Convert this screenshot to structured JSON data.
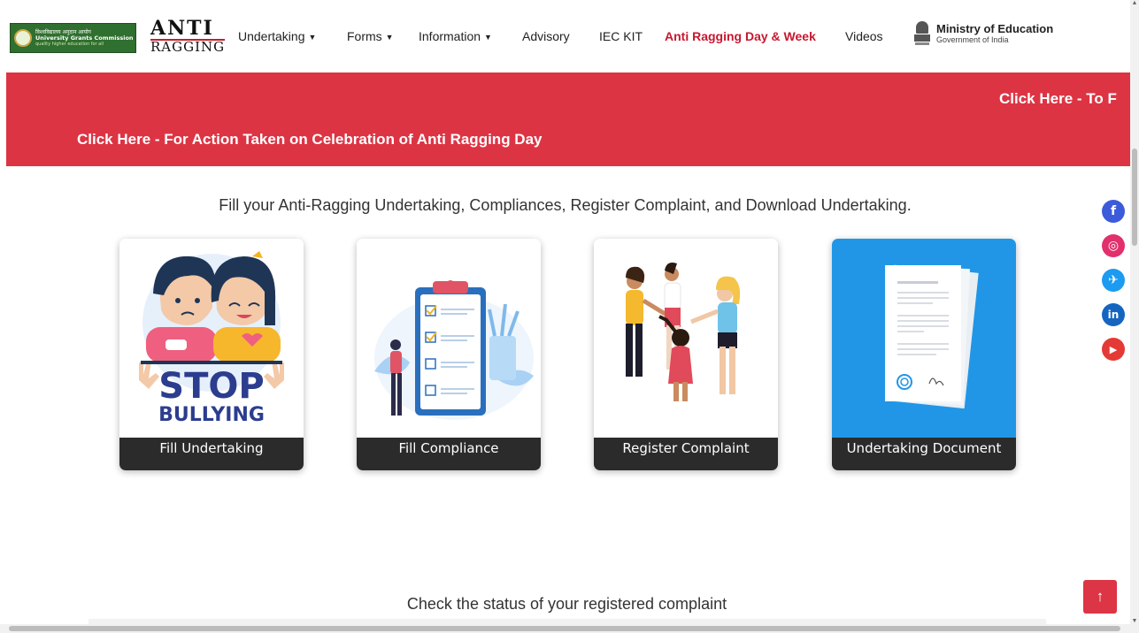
{
  "header": {
    "ugc_logo": {
      "line1": "विश्वविद्यालय अनुदान आयोग",
      "line2": "University Grants Commission",
      "line3": "quality higher education for all"
    },
    "anti_ragging_logo": {
      "top": "ANTI",
      "bottom": "RAGGING"
    },
    "nav": [
      {
        "label": "Undertaking",
        "dropdown": true
      },
      {
        "label": "Forms",
        "dropdown": true
      },
      {
        "label": "Information",
        "dropdown": true
      },
      {
        "label": "Advisory",
        "dropdown": false
      },
      {
        "label": "IEC KIT",
        "dropdown": false
      },
      {
        "label": "Anti Ragging Day & Week",
        "dropdown": false,
        "active": true
      },
      {
        "label": "Videos",
        "dropdown": false
      }
    ],
    "ministry": {
      "title": "Ministry of Education",
      "subtitle": "Government of India"
    }
  },
  "banner": {
    "marquee_1": "Click Here - To F",
    "marquee_2": "Click Here - For Action Taken on Celebration of Anti Ragging Day"
  },
  "main": {
    "heading": "Fill your Anti-Ragging Undertaking, Compliances, Register Complaint, and Download Undertaking.",
    "cards": [
      {
        "label": "Fill Undertaking",
        "image": "stop-bullying-illustration",
        "stop_text": "STOP",
        "bullying_text": "BULLYING"
      },
      {
        "label": "Fill Compliance",
        "image": "clipboard-checklist-illustration"
      },
      {
        "label": "Register Complaint",
        "image": "ragging-people-illustration"
      },
      {
        "label": "Undertaking Document",
        "image": "document-pages-illustration",
        "accent": "#2196e6"
      }
    ],
    "status_heading": "Check the status of your registered complaint"
  },
  "social": [
    {
      "name": "facebook-icon",
      "glyph": "f",
      "color": "#3b5bdb"
    },
    {
      "name": "instagram-icon",
      "glyph": "◎",
      "color": "#e1306c"
    },
    {
      "name": "twitter-icon",
      "glyph": "✈",
      "color": "#1d9bf0"
    },
    {
      "name": "linkedin-icon",
      "glyph": "in",
      "color": "#1565c0"
    },
    {
      "name": "youtube-icon",
      "glyph": "▶",
      "color": "#e53935"
    }
  ],
  "colors": {
    "brand_red": "#dd3444",
    "active_nav": "#c7172f",
    "card_label_bg": "#2b2b2b"
  },
  "scroll_top_glyph": "↑"
}
